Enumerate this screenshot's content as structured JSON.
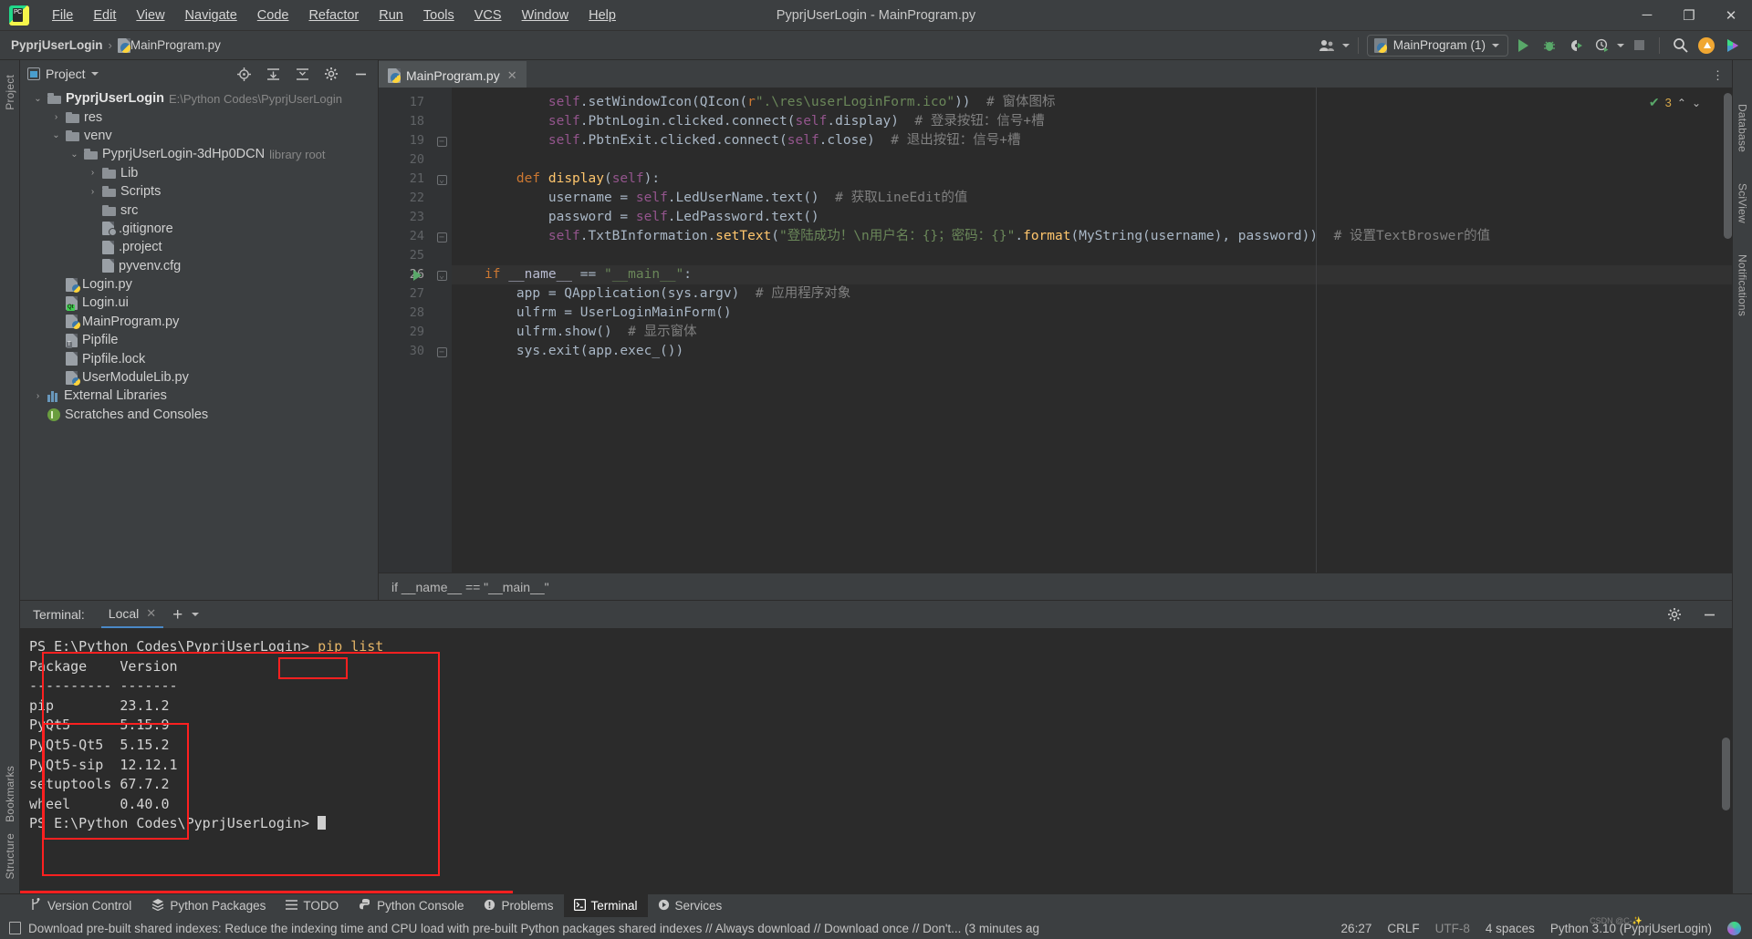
{
  "window": {
    "title": "PyprjUserLogin - MainProgram.py",
    "minimize": "─",
    "maximize": "❐",
    "close": "✕"
  },
  "menubar": {
    "logo": "pycharm-logo",
    "items": [
      "File",
      "Edit",
      "View",
      "Navigate",
      "Code",
      "Refactor",
      "Run",
      "Tools",
      "VCS",
      "Window",
      "Help"
    ]
  },
  "navbar": {
    "breadcrumb": [
      "PyprjUserLogin",
      "MainProgram.py"
    ],
    "separator": "›",
    "run_config": "MainProgram (1)",
    "buttons": [
      "run-button",
      "debug-button",
      "coverage-button",
      "profile-button",
      "stop-button",
      "search-everywhere-button",
      "update-button",
      "ide-features-button"
    ]
  },
  "project_panel": {
    "title": "Project",
    "header_icons": [
      "locate-icon",
      "expand-all-icon",
      "collapse-all-icon",
      "settings-icon",
      "hide-icon"
    ],
    "tree": [
      {
        "indent": 0,
        "arrow": "⌄",
        "icon": "folder",
        "label": "PyprjUserLogin",
        "bold": true,
        "dim": "E:\\Python Codes\\PyprjUserLogin"
      },
      {
        "indent": 1,
        "arrow": "›",
        "icon": "folder",
        "label": "res",
        "bold": false,
        "dim": ""
      },
      {
        "indent": 1,
        "arrow": "⌄",
        "icon": "folder",
        "label": "venv",
        "bold": false,
        "dim": ""
      },
      {
        "indent": 2,
        "arrow": "⌄",
        "icon": "folder",
        "label": "PyprjUserLogin-3dHp0DCN",
        "bold": false,
        "dim": "library root"
      },
      {
        "indent": 3,
        "arrow": "›",
        "icon": "folder",
        "label": "Lib",
        "bold": false,
        "dim": ""
      },
      {
        "indent": 3,
        "arrow": "›",
        "icon": "folder",
        "label": "Scripts",
        "bold": false,
        "dim": ""
      },
      {
        "indent": 3,
        "arrow": "",
        "icon": "folder",
        "label": "src",
        "bold": false,
        "dim": ""
      },
      {
        "indent": 3,
        "arrow": "",
        "icon": "gitignore-file",
        "label": ".gitignore",
        "bold": false,
        "dim": ""
      },
      {
        "indent": 3,
        "arrow": "",
        "icon": "file",
        "label": ".project",
        "bold": false,
        "dim": ""
      },
      {
        "indent": 3,
        "arrow": "",
        "icon": "cfg-file",
        "label": "pyvenv.cfg",
        "bold": false,
        "dim": ""
      },
      {
        "indent": 1,
        "arrow": "",
        "icon": "python-file",
        "label": "Login.py",
        "bold": false,
        "dim": ""
      },
      {
        "indent": 1,
        "arrow": "",
        "icon": "qt-file",
        "label": "Login.ui",
        "bold": false,
        "dim": ""
      },
      {
        "indent": 1,
        "arrow": "",
        "icon": "python-file",
        "label": "MainProgram.py",
        "bold": false,
        "dim": ""
      },
      {
        "indent": 1,
        "arrow": "",
        "icon": "pipfile",
        "label": "Pipfile",
        "bold": false,
        "dim": ""
      },
      {
        "indent": 1,
        "arrow": "",
        "icon": "file",
        "label": "Pipfile.lock",
        "bold": false,
        "dim": ""
      },
      {
        "indent": 1,
        "arrow": "",
        "icon": "python-file",
        "label": "UserModuleLib.py",
        "bold": false,
        "dim": ""
      },
      {
        "indent": 0,
        "arrow": "›",
        "icon": "library-icon",
        "label": "External Libraries",
        "bold": false,
        "dim": ""
      },
      {
        "indent": 0,
        "arrow": "",
        "icon": "scratches-icon",
        "label": "Scratches and Consoles",
        "bold": false,
        "dim": ""
      }
    ]
  },
  "editor": {
    "tab": "MainProgram.py",
    "tab_close": "✕",
    "inspection_count": "3",
    "breadcrumb": "if __name__ == \"__main__\"",
    "first_line": 17,
    "lines": [
      {
        "n": 17,
        "text": "        self.setWindowIcon(QIcon(r\".\\res\\userLoginForm.ico\"))  # 窗体图标"
      },
      {
        "n": 18,
        "text": "        self.PbtnLogin.clicked.connect(self.display)  # 登录按钮：信号+槽"
      },
      {
        "n": 19,
        "text": "        self.PbtnExit.clicked.connect(self.close)  # 退出按钮：信号+槽"
      },
      {
        "n": 20,
        "text": ""
      },
      {
        "n": 21,
        "text": "    def display(self):"
      },
      {
        "n": 22,
        "text": "        username = self.LedUserName.text()  # 获取LineEdit的值"
      },
      {
        "n": 23,
        "text": "        password = self.LedPassword.text()"
      },
      {
        "n": 24,
        "text": "        self.TxtBInformation.setText(\"登陆成功！\\n用户名：{}；密码：{}\".format(MyString(username), password))  # 设置TextBroswer的值"
      },
      {
        "n": 25,
        "text": ""
      },
      {
        "n": 26,
        "text": "if __name__ == \"__main__\":"
      },
      {
        "n": 27,
        "text": "    app = QApplication(sys.argv)  # 应用程序对象"
      },
      {
        "n": 28,
        "text": "    ulfrm = UserLoginMainForm()"
      },
      {
        "n": 29,
        "text": "    ulfrm.show()  # 显示窗体"
      },
      {
        "n": 30,
        "text": "    sys.exit(app.exec_())"
      }
    ]
  },
  "terminal": {
    "label": "Terminal:",
    "tab": "Local",
    "tab_close": "✕",
    "add": "+",
    "dropdown": "⌄",
    "settings_icon": "gear-icon",
    "hide_icon": "minimize-icon",
    "prompt": "PS E:\\Python Codes\\PyprjUserLogin>",
    "command": "pip list",
    "header": "Package    Version",
    "divider": "---------- -------",
    "packages": [
      {
        "name": "pip",
        "version": "23.1.2"
      },
      {
        "name": "PyQt5",
        "version": "5.15.9"
      },
      {
        "name": "PyQt5-Qt5",
        "version": "5.15.2"
      },
      {
        "name": "PyQt5-sip",
        "version": "12.12.1"
      },
      {
        "name": "setuptools",
        "version": "67.7.2"
      },
      {
        "name": "wheel",
        "version": "0.40.0"
      }
    ],
    "final_prompt": "PS E:\\Python Codes\\PyprjUserLogin>"
  },
  "left_rail": [
    "Project",
    "Structure",
    "Bookmarks"
  ],
  "right_rail": [
    "Database",
    "SciView",
    "Notifications"
  ],
  "toolwindow_bar": [
    {
      "label": "Version Control",
      "icon": "branch-icon",
      "active": false
    },
    {
      "label": "Python Packages",
      "icon": "packages-icon",
      "active": false
    },
    {
      "label": "TODO",
      "icon": "todo-icon",
      "active": false
    },
    {
      "label": "Python Console",
      "icon": "python-console-icon",
      "active": false
    },
    {
      "label": "Problems",
      "icon": "problems-icon",
      "active": false
    },
    {
      "label": "Terminal",
      "icon": "terminal-icon",
      "active": true
    },
    {
      "label": "Services",
      "icon": "services-icon",
      "active": false
    }
  ],
  "statusbar": {
    "message": "Download pre-built shared indexes: Reduce the indexing time and CPU load with pre-built Python packages shared indexes // Always download // Download once // Don't... (3 minutes ag",
    "caret": "26:27",
    "line_sep": "CRLF",
    "encoding": "UTF-8",
    "indent": "4 spaces",
    "interpreter": "Python 3.10 (PyprjUserLogin)",
    "watermark": "CSDN @C-✨"
  },
  "colors": {
    "accent": "#4a88c7",
    "run_green": "#59a869",
    "highlight_red": "#ff2020",
    "keyword": "#cc7832",
    "string": "#6a8759",
    "comment": "#808080",
    "self": "#94558d",
    "function": "#ffc66d"
  }
}
